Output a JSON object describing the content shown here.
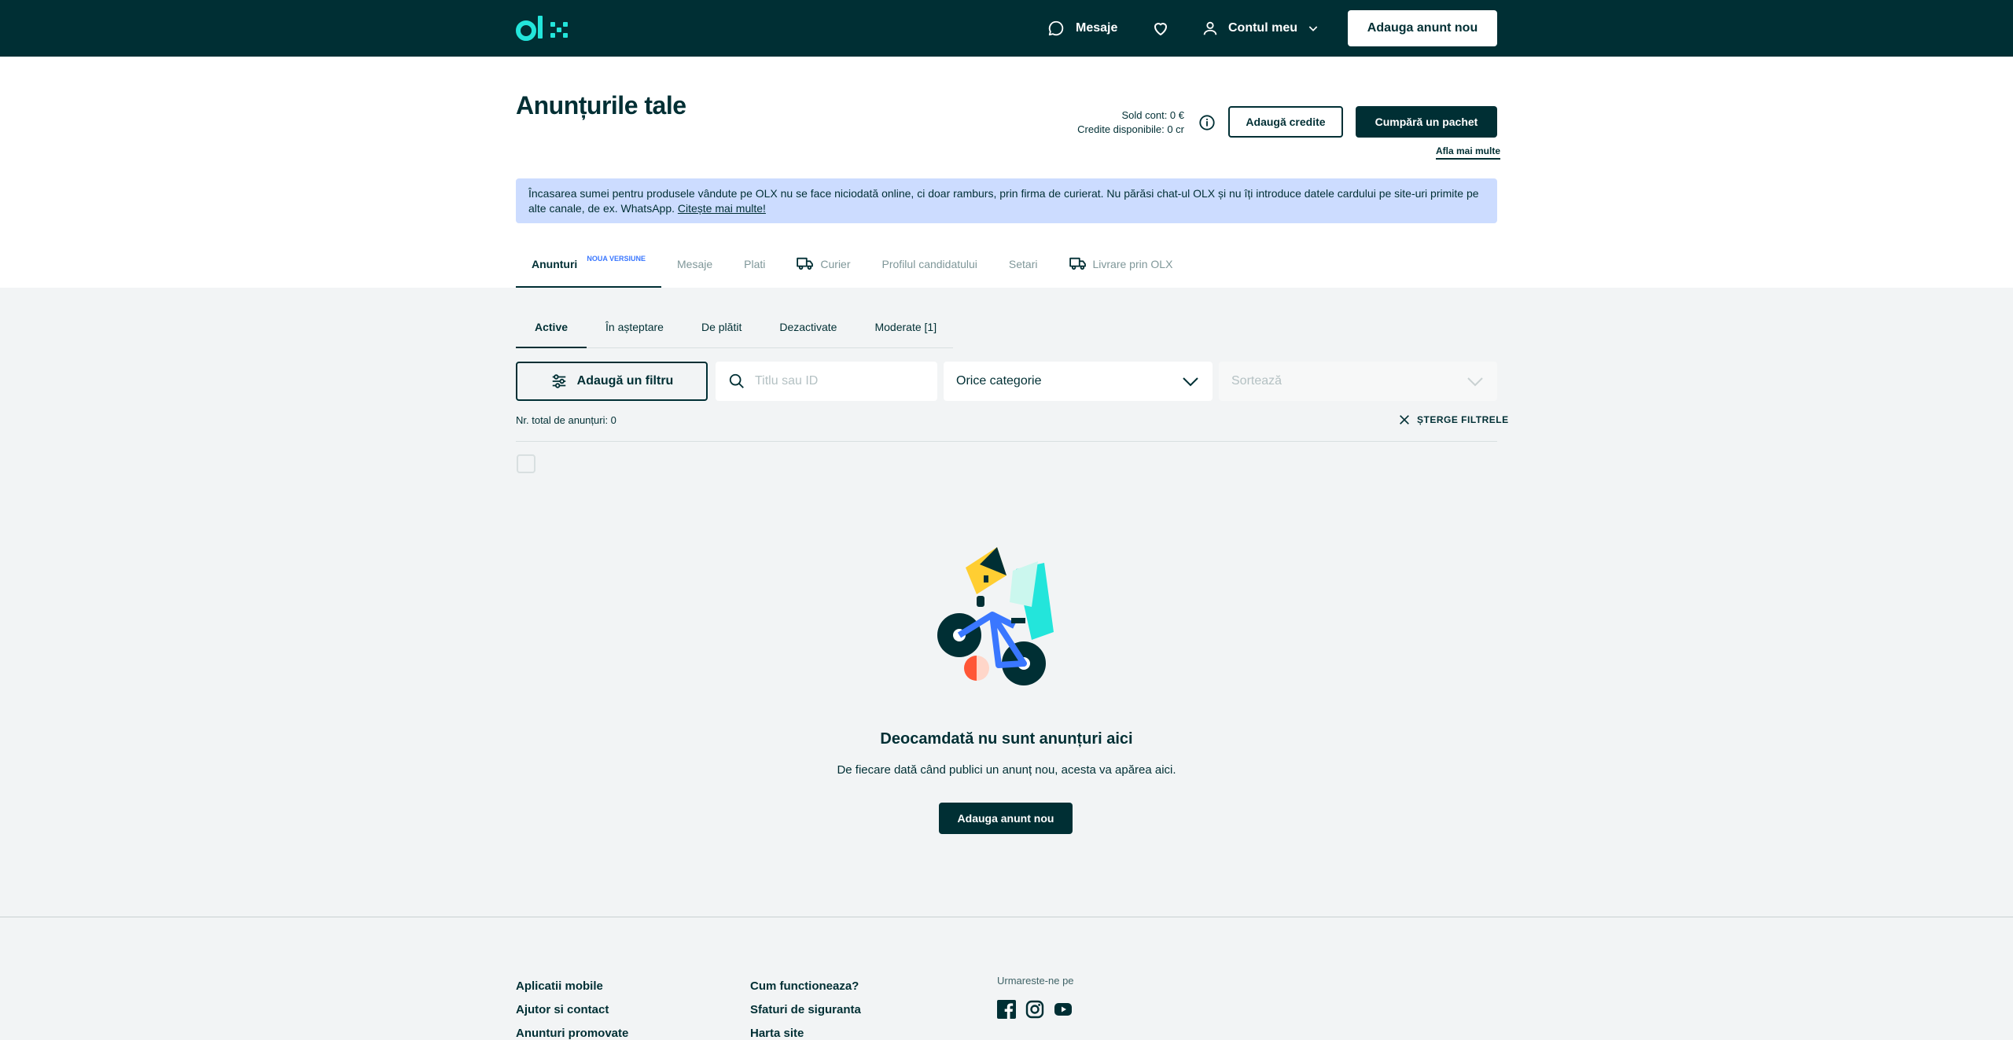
{
  "header": {
    "logo_text": "olx",
    "messages_label": "Mesaje",
    "account_label": "Contul meu",
    "post_ad_label": "Adauga anunt nou"
  },
  "page": {
    "title": "Anunțurile tale",
    "balance_line": "Sold cont: 0 €",
    "credits_line": "Credite disponibile: 0 cr",
    "add_credits_label": "Adaugă credite",
    "buy_package_label": "Cumpără un pachet",
    "learn_more_label": "Afla mai multe"
  },
  "notice": {
    "text": "Încasarea sumei pentru produsele vândute pe OLX nu se face niciodată online, ci doar ramburs, prin firma de curierat. Nu părăsi chat-ul OLX și nu îți introduce datele cardului pe site-uri primite pe alte canale, de ex. WhatsApp.",
    "link": "Citește mai multe!"
  },
  "tabs": [
    {
      "label": "Anunturi",
      "badge": "NOUA VERSIUNE"
    },
    {
      "label": "Mesaje"
    },
    {
      "label": "Plati"
    },
    {
      "label": "Curier"
    },
    {
      "label": "Profilul candidatului"
    },
    {
      "label": "Setari"
    },
    {
      "label": "Livrare prin OLX"
    }
  ],
  "subtabs": [
    "Active",
    "În așteptare",
    "De plătit",
    "Dezactivate",
    "Moderate [1]"
  ],
  "filters": {
    "add_filter_label": "Adaugă un filtru",
    "search_placeholder": "Titlu sau ID",
    "category_value": "Orice categorie",
    "sort_placeholder": "Sortează"
  },
  "results": {
    "total_label": "Nr. total de anunțuri: 0",
    "clear_filters_label": "ȘTERGE FILTRELE"
  },
  "empty_state": {
    "title": "Deocamdată nu sunt anunțuri aici",
    "subtitle": "De fiecare dată când publici un anunț nou, acesta va apărea aici.",
    "button_label": "Adauga anunt nou"
  },
  "footer": {
    "col1": [
      "Aplicatii mobile",
      "Ajutor si contact",
      "Anunturi promovate"
    ],
    "col2": [
      "Cum functioneaza?",
      "Sfaturi de siguranta",
      "Harta site"
    ],
    "follow_label": "Urmareste-ne pe",
    "social_icons": [
      "facebook-icon",
      "instagram-icon",
      "youtube-icon"
    ]
  },
  "colors": {
    "brand_dark": "#002f34",
    "brand_teal": "#23e5db",
    "notice_bg": "#ccdcff",
    "badge_blue": "#3a77ff"
  }
}
